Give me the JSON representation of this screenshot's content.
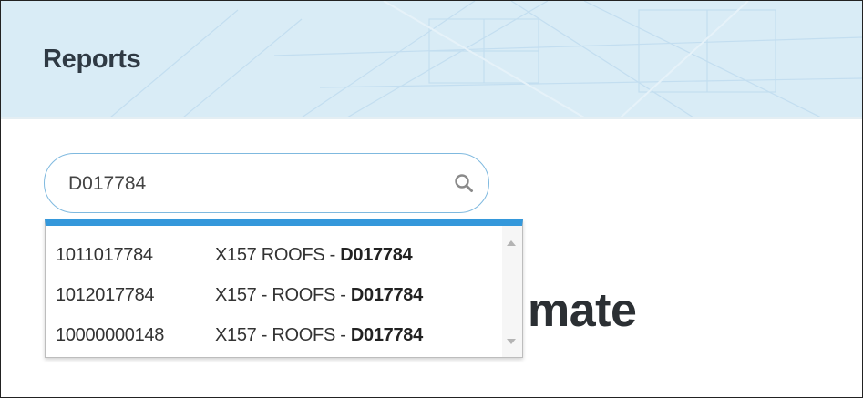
{
  "header": {
    "title": "Reports"
  },
  "search": {
    "value": "D017784",
    "placeholder": ""
  },
  "background_heading": "mate",
  "dropdown": {
    "items": [
      {
        "code": "1011017784",
        "desc_prefix": "X157 ROOFS - ",
        "match": "D017784"
      },
      {
        "code": "1012017784",
        "desc_prefix": "X157 - ROOFS - ",
        "match": "D017784"
      },
      {
        "code": "10000000148",
        "desc_prefix": "X157 - ROOFS - ",
        "match": "D017784"
      }
    ]
  },
  "colors": {
    "header_bg": "#d9ecf6",
    "accent": "#3498db",
    "search_border": "#7fb9df"
  },
  "icons": {
    "search": "search-icon",
    "scroll_up": "scroll-up-arrow-icon",
    "scroll_down": "scroll-down-arrow-icon"
  }
}
